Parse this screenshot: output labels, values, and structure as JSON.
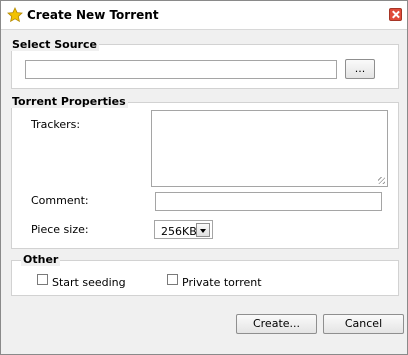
{
  "window": {
    "title": "Create New Torrent"
  },
  "source": {
    "legend": "Select Source",
    "path_value": "",
    "browse_label": "..."
  },
  "properties": {
    "legend": "Torrent Properties",
    "trackers_label": "Trackers:",
    "trackers_value": "",
    "comment_label": "Comment:",
    "comment_value": "",
    "piece_size_label": "Piece size:",
    "piece_size_value": "256KB"
  },
  "other": {
    "legend": "Other",
    "start_seeding_label": "Start seeding",
    "start_seeding_checked": false,
    "private_torrent_label": "Private torrent",
    "private_torrent_checked": false
  },
  "buttons": {
    "create_label": "Create...",
    "cancel_label": "Cancel"
  },
  "icons": {
    "title_icon": "star-icon",
    "close": "close-icon"
  },
  "colors": {
    "close_button": "#e04b3a",
    "title_star": "#f2c200"
  }
}
